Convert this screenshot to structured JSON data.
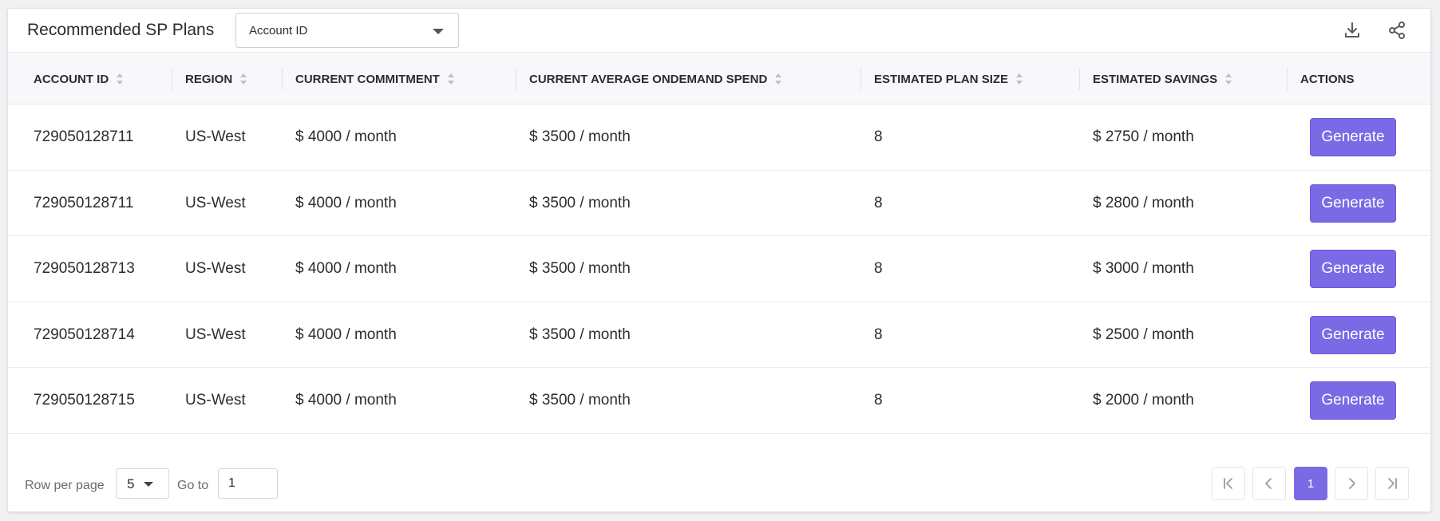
{
  "header": {
    "title": "Recommended SP Plans",
    "filter_selected": "Account ID",
    "download_icon": "download-icon",
    "share_icon": "share-icon"
  },
  "table": {
    "columns": [
      "ACCOUNT ID",
      "REGION",
      "CURRENT COMMITMENT",
      "CURRENT AVERAGE ONDEMAND SPEND",
      "ESTIMATED PLAN SIZE",
      "ESTIMATED SAVINGS",
      "ACTIONS"
    ],
    "rows": [
      [
        "729050128711",
        "US-West",
        "$ 4000 / month",
        "$ 3500 / month",
        "8",
        "$ 2750 / month",
        "Generate"
      ],
      [
        "729050128711",
        "US-West",
        "$ 4000 / month",
        "$ 3500 / month",
        "8",
        "$ 2800 / month",
        "Generate"
      ],
      [
        "729050128713",
        "US-West",
        "$ 4000 / month",
        "$ 3500 / month",
        "8",
        "$ 3000 / month",
        "Generate"
      ],
      [
        "729050128714",
        "US-West",
        "$ 4000 / month",
        "$ 3500 / month",
        "8",
        "$ 2500 / month",
        "Generate"
      ],
      [
        "729050128715",
        "US-West",
        "$ 4000 / month",
        "$ 3500 / month",
        "8",
        "$ 2000 / month",
        "Generate"
      ]
    ]
  },
  "pagination": {
    "rows_per_page_label": "Row per page",
    "rows_per_page_value": "5",
    "goto_label": "Go to",
    "goto_value": "1",
    "current_page": "1"
  },
  "colors": {
    "accent": "#7a6ae6"
  }
}
